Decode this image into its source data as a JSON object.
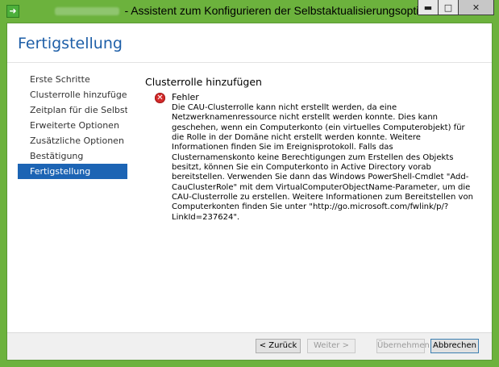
{
  "window": {
    "title_obscured": "",
    "title": "- Assistent zum Konfigurieren der Selbstaktualisierungsoptionen",
    "buttons": {
      "minimize": "▬",
      "maximize": "□",
      "close": "✕"
    }
  },
  "header": {
    "title": "Fertigstellung"
  },
  "nav": {
    "items": [
      {
        "label": "Erste Schritte",
        "active": false
      },
      {
        "label": "Clusterrolle hinzufügen",
        "active": false
      },
      {
        "label": "Zeitplan für die Selbstakt...",
        "active": false
      },
      {
        "label": "Erweiterte Optionen",
        "active": false
      },
      {
        "label": "Zusätzliche Optionen",
        "active": false
      },
      {
        "label": "Bestätigung",
        "active": false
      },
      {
        "label": "Fertigstellung",
        "active": true
      }
    ]
  },
  "content": {
    "section_title": "Clusterrolle hinzufügen",
    "error_label": "Fehler",
    "error_message": "Die CAU-Clusterrolle kann nicht erstellt werden, da eine Netzwerknamenressource nicht erstellt werden konnte. Dies kann geschehen, wenn ein Computerkonto (ein virtuelles Computerobjekt) für die Rolle in der Domäne nicht erstellt werden konnte. Weitere Informationen finden Sie im Ereignisprotokoll. Falls das Clusternamenskonto keine Berechtigungen zum Erstellen des Objekts besitzt, können Sie ein Computerkonto in Active Directory vorab bereitstellen. Verwenden Sie dann das Windows PowerShell-Cmdlet \"Add-CauClusterRole\" mit dem VirtualComputerObjectName-Parameter, um die CAU-Clusterrolle zu erstellen. Weitere Informationen zum Bereitstellen von Computerkonten finden Sie unter \"http://go.microsoft.com/fwlink/p/?LinkId=237624\"."
  },
  "footer": {
    "back": "< Zurück",
    "next": "Weiter >",
    "apply": "Übernehmen",
    "cancel": "Abbrechen"
  },
  "colors": {
    "frame": "#6cb23d",
    "accent": "#1c64b4",
    "error": "#d42a2a"
  }
}
